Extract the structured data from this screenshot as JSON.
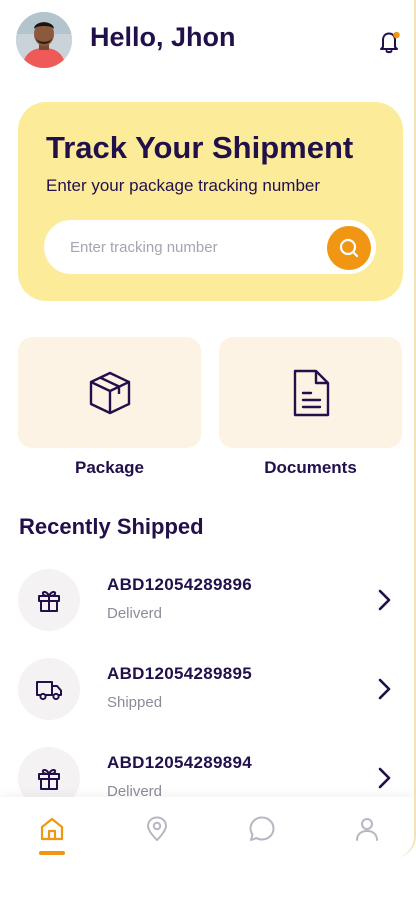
{
  "header": {
    "greeting": "Hello, Jhon",
    "avatar_icon": "user-avatar",
    "notification_icon": "bell-icon",
    "notification_dot_color": "#f09612"
  },
  "hero": {
    "title": "Track Your Shipment",
    "subtitle": "Enter your package tracking number",
    "search_placeholder": "Enter tracking number",
    "search_value": "",
    "background_color": "#fcec9a",
    "button_color": "#f09612"
  },
  "categories": [
    {
      "label": "Package",
      "icon": "box-icon"
    },
    {
      "label": "Documents",
      "icon": "document-icon"
    }
  ],
  "recent": {
    "title": "Recently Shipped",
    "items": [
      {
        "tracking_id": "ABD12054289896",
        "status": "Deliverd",
        "icon": "gift-icon"
      },
      {
        "tracking_id": "ABD12054289895",
        "status": "Shipped",
        "icon": "truck-icon"
      },
      {
        "tracking_id": "ABD12054289894",
        "status": "Deliverd",
        "icon": "gift-icon"
      }
    ]
  },
  "nav": {
    "items": [
      {
        "icon": "home-icon",
        "active": true
      },
      {
        "icon": "location-icon",
        "active": false
      },
      {
        "icon": "chat-icon",
        "active": false
      },
      {
        "icon": "profile-icon",
        "active": false
      }
    ],
    "active_color": "#f09612",
    "inactive_color": "#b9b6c2"
  }
}
